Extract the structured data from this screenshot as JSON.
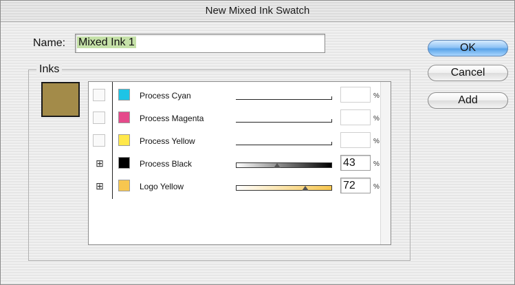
{
  "window": {
    "title": "New Mixed Ink Swatch"
  },
  "name_field": {
    "label": "Name:",
    "value": "Mixed Ink 1"
  },
  "buttons": {
    "ok": "OK",
    "cancel": "Cancel",
    "add": "Add"
  },
  "inks_group": {
    "label": "Inks"
  },
  "preview_color": "#a38b49",
  "inks": [
    {
      "name": "Process Cyan",
      "color": "#1ec4e6",
      "included": false,
      "percent": "",
      "percent_value": 0,
      "pct_symbol": "%"
    },
    {
      "name": "Process Magenta",
      "color": "#e54a8b",
      "included": false,
      "percent": "",
      "percent_value": 0,
      "pct_symbol": "%"
    },
    {
      "name": "Process Yellow",
      "color": "#ffe84a",
      "included": false,
      "percent": "",
      "percent_value": 0,
      "pct_symbol": "%"
    },
    {
      "name": "Process Black",
      "color": "#000000",
      "included": true,
      "percent": "43",
      "percent_value": 43,
      "pct_symbol": "%"
    },
    {
      "name": "Logo Yellow",
      "color": "#f7c64f",
      "included": true,
      "percent": "72",
      "percent_value": 72,
      "pct_symbol": "%"
    }
  ],
  "icons": {
    "include_toggle": "mixed-ink-include-icon"
  }
}
